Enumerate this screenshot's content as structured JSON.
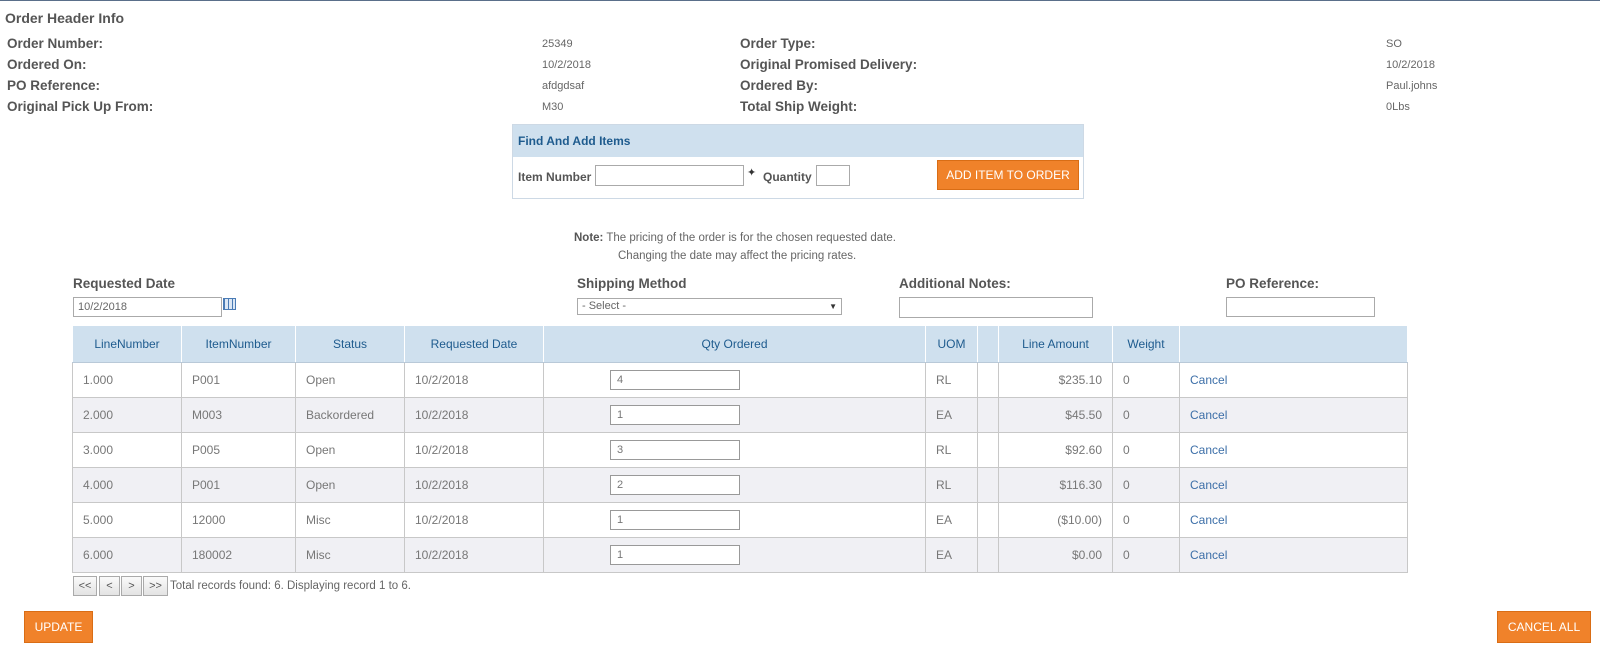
{
  "header": {
    "title": "Order Header Info",
    "fields": {
      "order_number": {
        "label": "Order Number:",
        "value": "25349"
      },
      "ordered_on": {
        "label": "Ordered On:",
        "value": "10/2/2018"
      },
      "po_reference": {
        "label": "PO Reference:",
        "value": "afdgdsaf"
      },
      "pickup_from": {
        "label": "Original Pick Up From:",
        "value": "M30"
      },
      "order_type": {
        "label": "Order Type:",
        "value": "SO"
      },
      "promised_delivery": {
        "label": "Original Promised Delivery:",
        "value": "10/2/2018"
      },
      "ordered_by": {
        "label": "Ordered By:",
        "value": "Paul.johns"
      },
      "ship_weight": {
        "label": "Total Ship Weight:",
        "value": "0Lbs"
      }
    }
  },
  "find_items": {
    "title": "Find And Add Items",
    "item_number_label": "Item Number",
    "quantity_label": "Quantity",
    "add_button": "ADD ITEM TO ORDER"
  },
  "note": {
    "prefix": "Note:",
    "line1": "The pricing of the order is for the chosen requested date.",
    "line2": "Changing the date may affect the pricing rates."
  },
  "form": {
    "requested_date_label": "Requested Date",
    "requested_date_value": "10/2/2018",
    "shipping_method_label": "Shipping Method",
    "shipping_method_value": "- Select -",
    "notes_label": "Additional Notes:",
    "po_ref_label": "PO Reference:"
  },
  "table": {
    "headers": [
      "LineNumber",
      "ItemNumber",
      "Status",
      "Requested Date",
      "Qty Ordered",
      "UOM",
      "",
      "Line Amount",
      "Weight",
      ""
    ],
    "rows": [
      {
        "line": "1.000",
        "item": "P001",
        "status": "Open",
        "date": "10/2/2018",
        "qty": "4",
        "uom": "RL",
        "amount": "$235.10",
        "weight": "0",
        "action": "Cancel"
      },
      {
        "line": "2.000",
        "item": "M003",
        "status": "Backordered",
        "date": "10/2/2018",
        "qty": "1",
        "uom": "EA",
        "amount": "$45.50",
        "weight": "0",
        "action": "Cancel"
      },
      {
        "line": "3.000",
        "item": "P005",
        "status": "Open",
        "date": "10/2/2018",
        "qty": "3",
        "uom": "RL",
        "amount": "$92.60",
        "weight": "0",
        "action": "Cancel"
      },
      {
        "line": "4.000",
        "item": "P001",
        "status": "Open",
        "date": "10/2/2018",
        "qty": "2",
        "uom": "RL",
        "amount": "$116.30",
        "weight": "0",
        "action": "Cancel"
      },
      {
        "line": "5.000",
        "item": "12000",
        "status": "Misc",
        "date": "10/2/2018",
        "qty": "1",
        "uom": "EA",
        "amount": "($10.00)",
        "weight": "0",
        "action": "Cancel"
      },
      {
        "line": "6.000",
        "item": "180002",
        "status": "Misc",
        "date": "10/2/2018",
        "qty": "1",
        "uom": "EA",
        "amount": "$0.00",
        "weight": "0",
        "action": "Cancel"
      }
    ]
  },
  "pager": {
    "first": "<<",
    "prev": "<",
    "next": ">",
    "last": ">>",
    "text": "Total records found: 6. Displaying record 1 to 6."
  },
  "actions": {
    "update": "UPDATE",
    "cancel_all": "CANCEL ALL"
  }
}
